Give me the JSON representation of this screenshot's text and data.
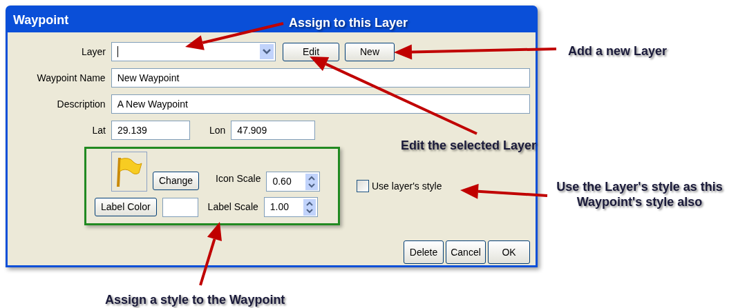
{
  "window": {
    "title": "Waypoint"
  },
  "layer": {
    "label": "Layer",
    "edit_button": "Edit",
    "new_button": "New"
  },
  "waypoint_name": {
    "label": "Waypoint Name",
    "value": "New Waypoint"
  },
  "description": {
    "label": "Description",
    "value": "A New Waypoint"
  },
  "lat": {
    "label": "Lat",
    "value": "29.139"
  },
  "lon": {
    "label": "Lon",
    "value": "47.909"
  },
  "style": {
    "change_button": "Change",
    "icon_scale": {
      "label": "Icon Scale",
      "value": "0.60"
    },
    "label_color_button": "Label Color",
    "label_scale": {
      "label": "Label Scale",
      "value": "1.00"
    }
  },
  "use_layer_style": {
    "label": "Use layer's style",
    "checked": false
  },
  "buttons": [
    "Delete",
    "Cancel",
    "OK"
  ],
  "annotations": [
    {
      "text": "Assign to this Layer"
    },
    {
      "text": "Add a new Layer"
    },
    {
      "text": "Edit the selected Layer"
    },
    {
      "text": "Use the Layer's style as this Waypoint's style also"
    },
    {
      "text": "Assign a style to the Waypoint"
    }
  ]
}
